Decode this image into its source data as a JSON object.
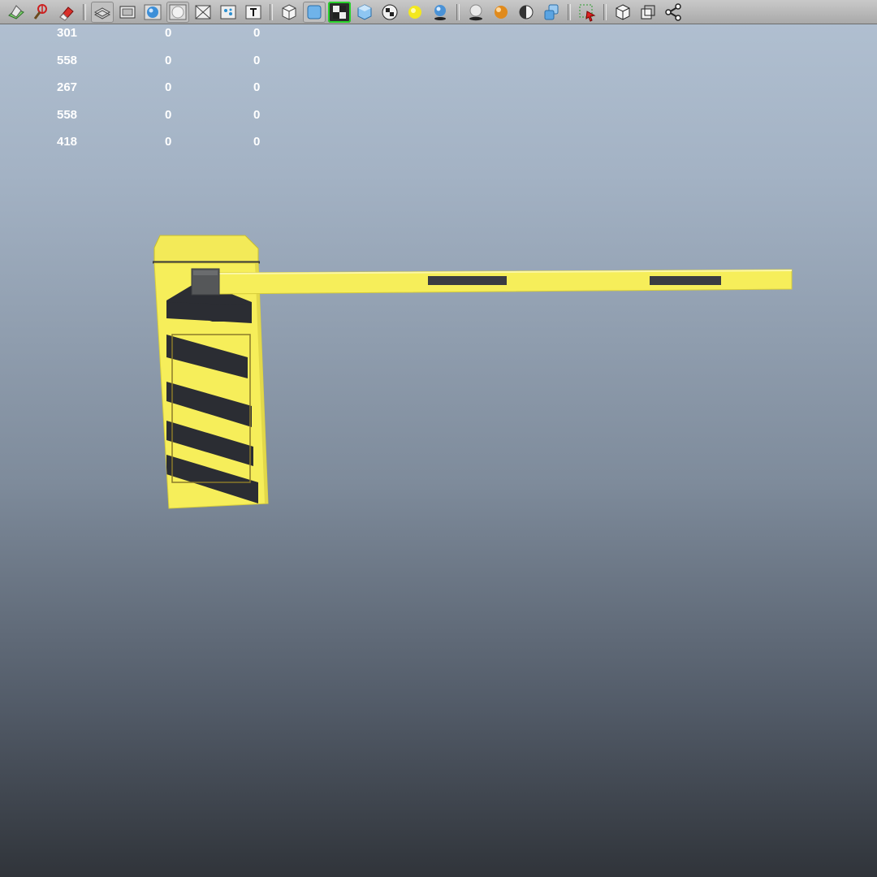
{
  "toolbar": {
    "icons": [
      "isolate-icon",
      "pivot-icon",
      "eraser-icon",
      "wireframe-on-shaded-icon",
      "film-frame-icon",
      "sphere-shaded-icon",
      "sphere-outline-icon",
      "xray-icon",
      "uv-icon",
      "text-icon",
      "wireframe-cube-icon",
      "smooth-shade-cube-icon",
      "texture-icon",
      "cube-icon",
      "checker-icon",
      "default-light-icon",
      "all-lights-icon",
      "shadow-icon",
      "material-sphere-icon",
      "half-sphere-icon",
      "layered-cubes-icon",
      "select-region-icon",
      "box-icon",
      "two-panes-icon",
      "share-nodes-icon"
    ]
  },
  "stats": {
    "rows": [
      [
        "301",
        "0",
        "0"
      ],
      [
        "558",
        "0",
        "0"
      ],
      [
        "267",
        "0",
        "0"
      ],
      [
        "558",
        "0",
        "0"
      ],
      [
        "418",
        "0",
        "0"
      ]
    ]
  },
  "scene": {
    "object": "boom-barrier",
    "colors": {
      "barrier_yellow": "#f6ee5a",
      "stripe_black": "#2b2d33",
      "background_top": "#b2c1d2",
      "background_bottom": "#30343a"
    }
  }
}
